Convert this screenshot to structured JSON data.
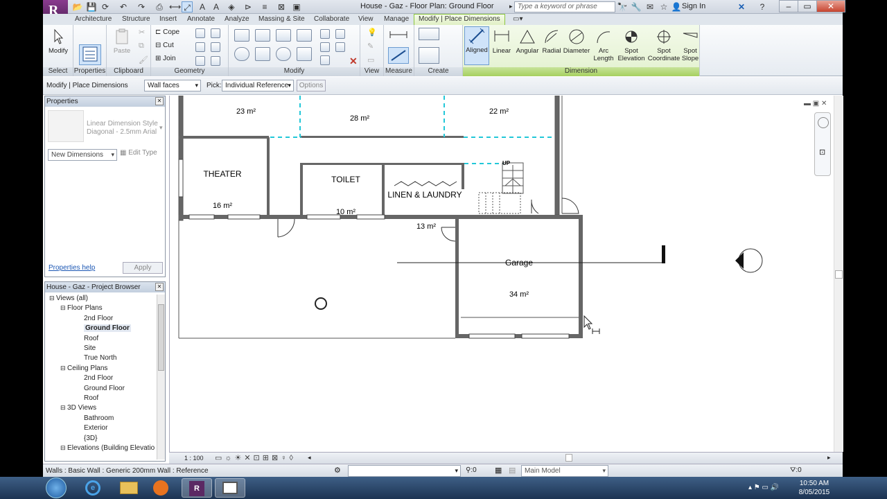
{
  "window": {
    "title": "House - Gaz - Floor Plan: Ground Floor",
    "search_placeholder": "Type a keyword or phrase",
    "sign_in": "Sign In"
  },
  "tabs": [
    "Architecture",
    "Structure",
    "Insert",
    "Annotate",
    "Analyze",
    "Massing & Site",
    "Collaborate",
    "View",
    "Manage",
    "Modify | Place Dimensions"
  ],
  "ribbon": {
    "select": {
      "modify": "Modify",
      "label": "Select"
    },
    "properties": {
      "label": "Properties"
    },
    "clipboard": {
      "paste": "Paste",
      "label": "Clipboard"
    },
    "geometry": {
      "cope": "Cope",
      "cut": "Cut",
      "join": "Join",
      "label": "Geometry"
    },
    "modify_label": "Modify",
    "view_label": "View",
    "measure_label": "Measure",
    "create_label": "Create",
    "dimension": {
      "label": "Dimension",
      "tools": [
        "Aligned",
        "Linear",
        "Angular",
        "Radial",
        "Diameter",
        "Arc Length",
        "Spot Elevation",
        "Spot Coordinate",
        "Spot Slope"
      ]
    }
  },
  "options_bar": {
    "context": "Modify | Place Dimensions",
    "placement": "Wall faces",
    "pick_label": "Pick:",
    "pick_value": "Individual Reference",
    "options_btn": "Options"
  },
  "properties": {
    "title": "Properties",
    "type_name": "Linear Dimension Style",
    "type_sub": "Diagonal - 2.5mm Arial",
    "selector": "New Dimensions",
    "edit_type": "Edit Type",
    "help": "Properties help",
    "apply": "Apply"
  },
  "browser": {
    "title": "House - Gaz - Project Browser",
    "items": [
      {
        "label": "Views (all)",
        "level": 0
      },
      {
        "label": "Floor Plans",
        "level": 1
      },
      {
        "label": "2nd Floor",
        "level": 2
      },
      {
        "label": "Ground Floor",
        "level": 2,
        "selected": true
      },
      {
        "label": "Roof",
        "level": 2
      },
      {
        "label": "Site",
        "level": 2
      },
      {
        "label": "True North",
        "level": 2
      },
      {
        "label": "Ceiling Plans",
        "level": 1
      },
      {
        "label": "2nd Floor",
        "level": 2
      },
      {
        "label": "Ground Floor",
        "level": 2
      },
      {
        "label": "Roof",
        "level": 2
      },
      {
        "label": "3D Views",
        "level": 1
      },
      {
        "label": "Bathroom",
        "level": 2
      },
      {
        "label": "Exterior",
        "level": 2
      },
      {
        "label": "{3D}",
        "level": 2
      },
      {
        "label": "Elevations (Building Elevatio",
        "level": 1
      }
    ]
  },
  "plan": {
    "rooms": [
      {
        "name": "",
        "area": "23 m²"
      },
      {
        "name": "",
        "area": "28 m²"
      },
      {
        "name": "",
        "area": "22 m²"
      },
      {
        "name": "THEATER",
        "area": "16 m²"
      },
      {
        "name": "TOILET",
        "area": "10 m²"
      },
      {
        "name": "LINEN & LAUNDRY",
        "area": ""
      },
      {
        "name": "",
        "area": "13 m²"
      },
      {
        "name": "Garage",
        "area": "34 m²"
      }
    ],
    "stair_label": "UP"
  },
  "view_bar": {
    "scale": "1 : 100"
  },
  "status": {
    "text": "Walls : Basic Wall : Generic 200mm Wall : Reference",
    "count": ":0",
    "model": "Main Model",
    "filter_count": ":0"
  },
  "clock": {
    "time": "10:50 AM",
    "date": "8/05/2015"
  }
}
